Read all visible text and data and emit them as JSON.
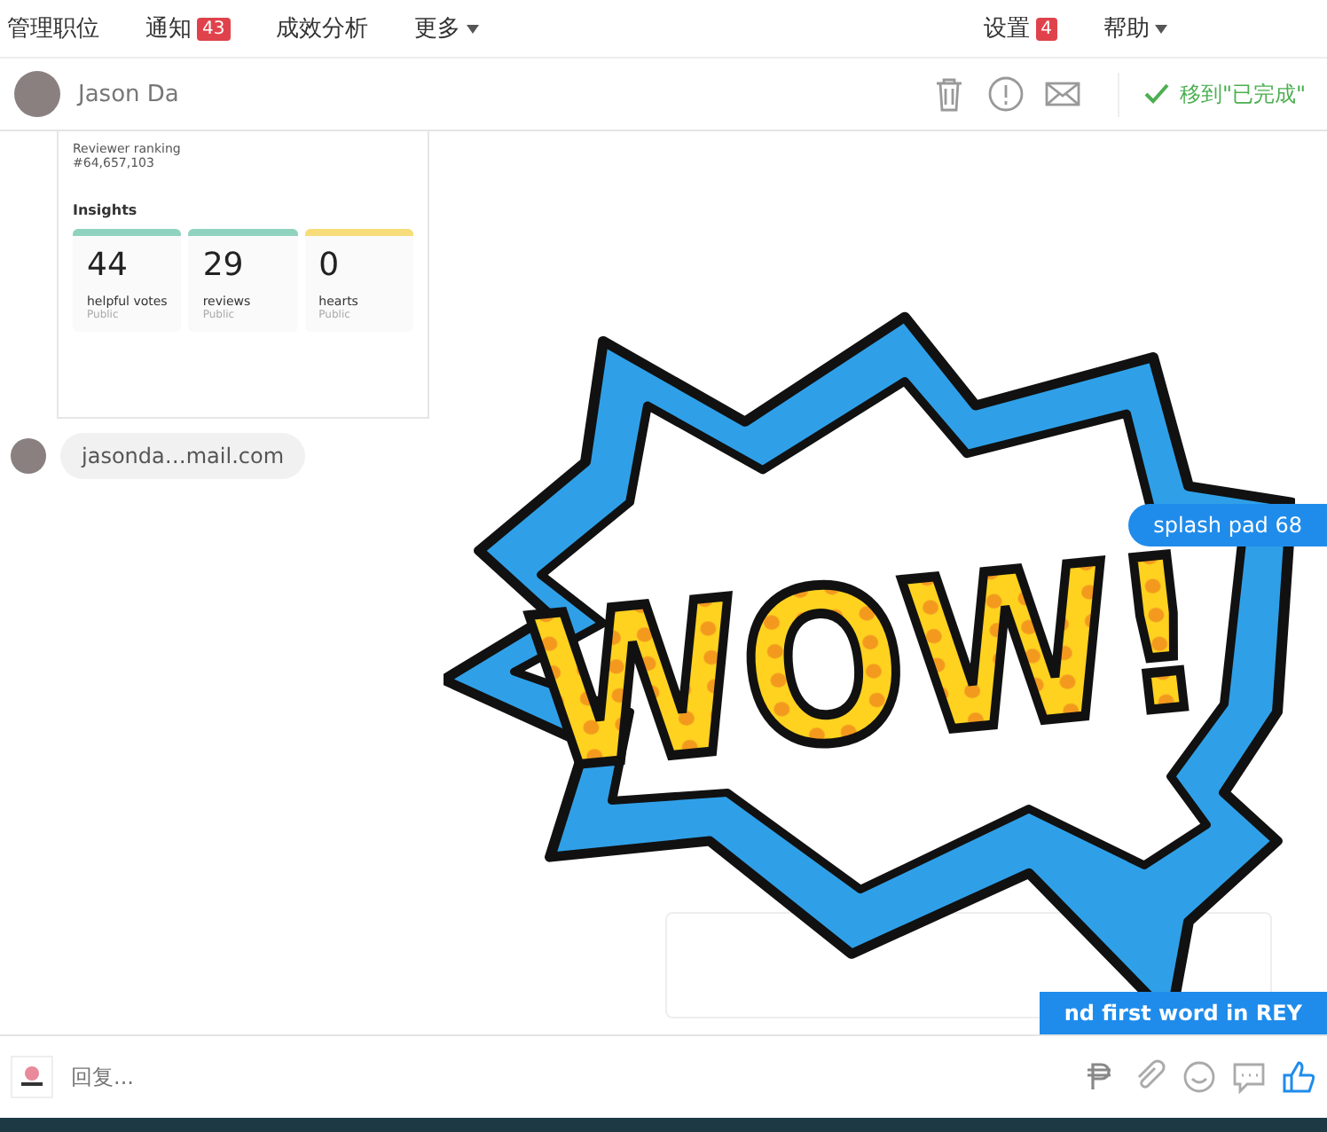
{
  "nav": {
    "items": [
      {
        "label": "管理职位"
      },
      {
        "label": "通知",
        "badge": "43"
      },
      {
        "label": "成效分析"
      },
      {
        "label": "更多",
        "dropdown": true
      }
    ],
    "right": [
      {
        "label": "设置",
        "badge": "4"
      },
      {
        "label": "帮助",
        "dropdown": true
      }
    ]
  },
  "conversation": {
    "name": "Jason Da",
    "move_button": "移到\"已完成\""
  },
  "profile_card": {
    "ranking_label": "Reviewer ranking",
    "ranking": "#64,657,103",
    "insights_title": "Insights",
    "stats": [
      {
        "value": "44",
        "label": "helpful votes",
        "sub": "Public",
        "color": "#8fd3bf"
      },
      {
        "value": "29",
        "label": "reviews",
        "sub": "Public",
        "color": "#8fd3bf"
      },
      {
        "value": "0",
        "label": "hearts",
        "sub": "Public",
        "color": "#f7dc7a"
      }
    ]
  },
  "messages": [
    {
      "kind": "incoming",
      "text": "jasonda…mail.com"
    },
    {
      "kind": "outgoing",
      "text": "splash pad 68"
    },
    {
      "kind": "outgoing",
      "text": "nd first word in REY"
    }
  ],
  "sticker": {
    "text": "WOW!"
  },
  "composer": {
    "placeholder": "回复..."
  }
}
